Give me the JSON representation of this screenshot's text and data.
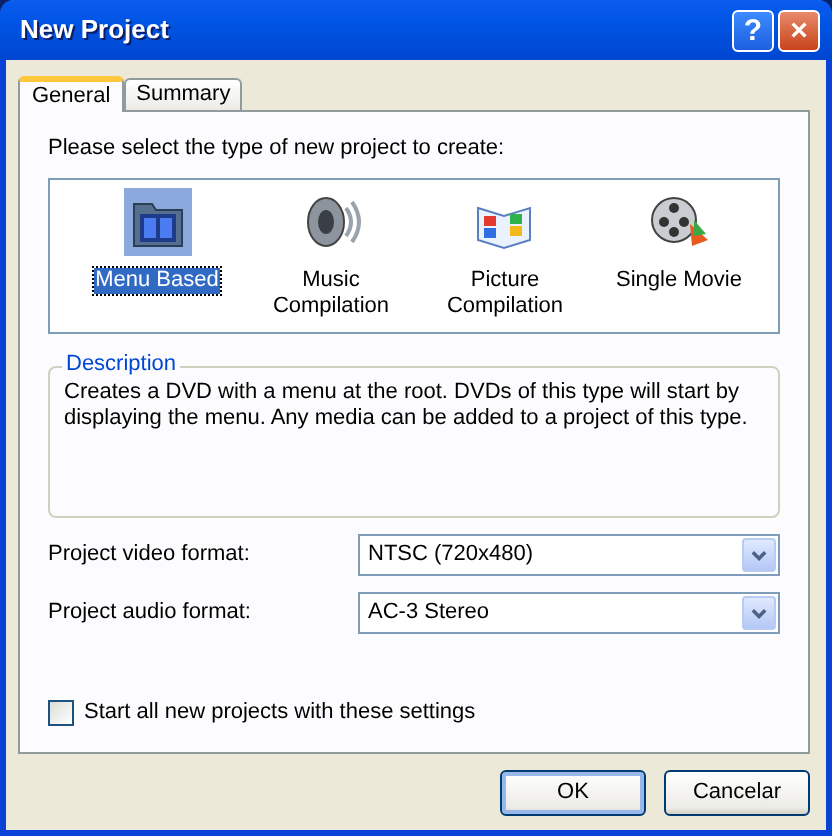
{
  "window": {
    "title": "New Project",
    "help_button": "?",
    "close_button": "×"
  },
  "tabs": [
    {
      "label": "General",
      "selected": true
    },
    {
      "label": "Summary",
      "selected": false
    }
  ],
  "prompt": "Please select the type of new project to create:",
  "project_types": [
    {
      "label": "Menu Based",
      "kind": "menu",
      "selected": true
    },
    {
      "label": "Music Compilation",
      "kind": "music",
      "selected": false
    },
    {
      "label": "Picture Compilation",
      "kind": "picture",
      "selected": false
    },
    {
      "label": "Single Movie",
      "kind": "movie",
      "selected": false
    }
  ],
  "description": {
    "legend": "Description",
    "text": "Creates a DVD with a menu at the root.  DVDs of this type will start by displaying the menu.  Any media can be added to a project of this type."
  },
  "formats": [
    {
      "label": "Project video format:",
      "value": "NTSC (720x480)"
    },
    {
      "label": "Project audio format:",
      "value": "AC-3 Stereo"
    }
  ],
  "remember": {
    "label": "Start all new projects with these settings",
    "checked": false
  },
  "buttons": [
    {
      "label": "OK",
      "default": true
    },
    {
      "label": "Cancelar",
      "default": false
    }
  ]
}
